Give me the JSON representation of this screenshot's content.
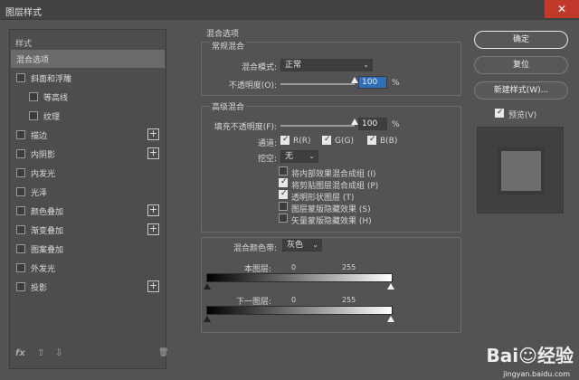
{
  "window": {
    "title": "图层样式",
    "close_glyph": "✕"
  },
  "left_panel": {
    "header": "样式",
    "items": [
      {
        "label": "混合选项",
        "has_checkbox": false,
        "checked": false,
        "plus": false,
        "indent": 0,
        "selected": true
      },
      {
        "label": "斜面和浮雕",
        "has_checkbox": true,
        "checked": false,
        "plus": false,
        "indent": 0,
        "selected": false
      },
      {
        "label": "等高线",
        "has_checkbox": true,
        "checked": false,
        "plus": false,
        "indent": 1,
        "selected": false
      },
      {
        "label": "纹理",
        "has_checkbox": true,
        "checked": false,
        "plus": false,
        "indent": 1,
        "selected": false
      },
      {
        "label": "描边",
        "has_checkbox": true,
        "checked": false,
        "plus": true,
        "indent": 0,
        "selected": false
      },
      {
        "label": "内阴影",
        "has_checkbox": true,
        "checked": false,
        "plus": true,
        "indent": 0,
        "selected": false
      },
      {
        "label": "内发光",
        "has_checkbox": true,
        "checked": false,
        "plus": false,
        "indent": 0,
        "selected": false
      },
      {
        "label": "光泽",
        "has_checkbox": true,
        "checked": false,
        "plus": false,
        "indent": 0,
        "selected": false
      },
      {
        "label": "颜色叠加",
        "has_checkbox": true,
        "checked": false,
        "plus": true,
        "indent": 0,
        "selected": false
      },
      {
        "label": "渐变叠加",
        "has_checkbox": true,
        "checked": false,
        "plus": true,
        "indent": 0,
        "selected": false
      },
      {
        "label": "图案叠加",
        "has_checkbox": true,
        "checked": false,
        "plus": false,
        "indent": 0,
        "selected": false
      },
      {
        "label": "外发光",
        "has_checkbox": true,
        "checked": false,
        "plus": false,
        "indent": 0,
        "selected": false
      },
      {
        "label": "投影",
        "has_checkbox": true,
        "checked": false,
        "plus": true,
        "indent": 0,
        "selected": false
      }
    ],
    "footer": {
      "fx": "fx",
      "up": "⇧",
      "down": "⇩",
      "trash": "🗑"
    }
  },
  "blend_options": {
    "title": "混合选项",
    "general": {
      "title": "常规混合",
      "mode_label": "混合模式:",
      "mode_value": "正常",
      "opacity_label": "不透明度(O):",
      "opacity_value": "100",
      "opacity_fraction": 1.0,
      "percent": "%"
    },
    "advanced": {
      "title": "高级混合",
      "fill_label": "填充不透明度(F):",
      "fill_value": "100",
      "fill_fraction": 1.0,
      "percent": "%",
      "channels_label": "通道:",
      "channels": [
        {
          "label": "R(R)",
          "checked": true
        },
        {
          "label": "G(G)",
          "checked": true
        },
        {
          "label": "B(B)",
          "checked": true
        }
      ],
      "knockout_label": "挖空:",
      "knockout_value": "无",
      "options": [
        {
          "label": "将内部效果混合成组 (I)",
          "checked": false
        },
        {
          "label": "将剪贴图层混合成组 (P)",
          "checked": true
        },
        {
          "label": "透明形状图层 (T)",
          "checked": true
        },
        {
          "label": "图层蒙版隐藏效果 (S)",
          "checked": false
        },
        {
          "label": "矢量蒙版隐藏效果 (H)",
          "checked": false
        }
      ]
    },
    "blend_if": {
      "label": "混合颜色带:",
      "value": "灰色",
      "this_layer_label": "本图层:",
      "this_layer_min": "0",
      "this_layer_max": "255",
      "underlying_label": "下一图层:",
      "underlying_min": "0",
      "underlying_max": "255"
    }
  },
  "buttons": {
    "ok": "确定",
    "reset": "复位",
    "new_style": "新建样式(W)...",
    "preview_label": "预览(V)",
    "preview_checked": true
  },
  "watermark": {
    "brand": "Bai☺经验",
    "url": "jingyan.baidu.com"
  }
}
